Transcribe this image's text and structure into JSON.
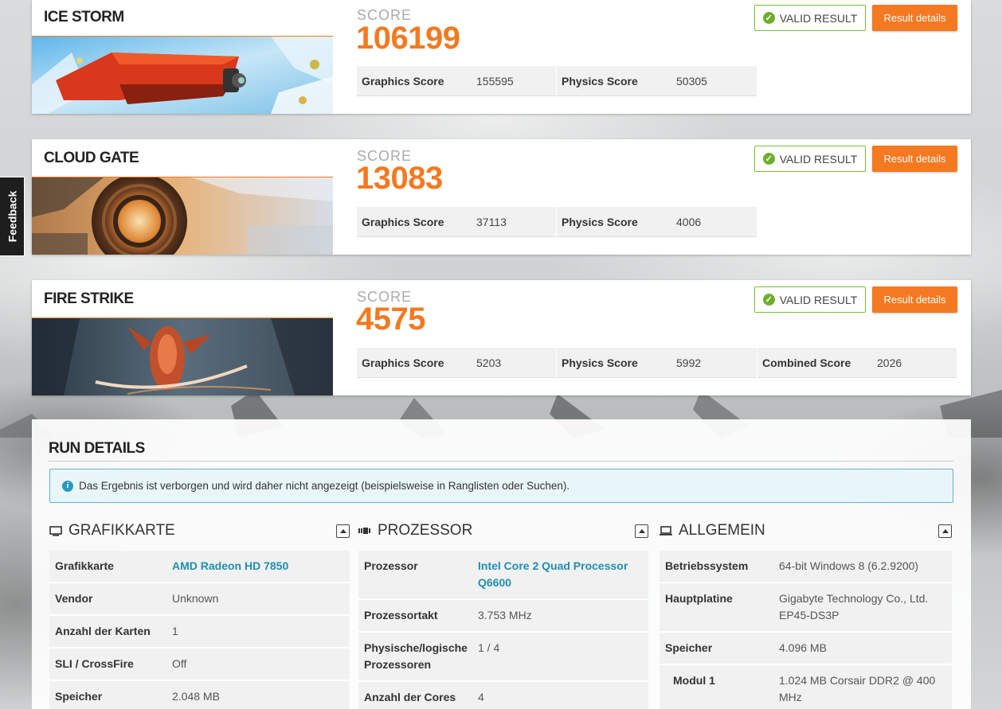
{
  "feedback": {
    "label": "Feedback"
  },
  "benchmarks": [
    {
      "title": "ICE STORM",
      "score_label": "SCORE",
      "score": "106199",
      "valid_label": "VALID RESULT",
      "details_label": "Result details",
      "subscores": [
        {
          "name": "Graphics Score",
          "value": "155595"
        },
        {
          "name": "Physics Score",
          "value": "50305"
        }
      ]
    },
    {
      "title": "CLOUD GATE",
      "score_label": "SCORE",
      "score": "13083",
      "valid_label": "VALID RESULT",
      "details_label": "Result details",
      "subscores": [
        {
          "name": "Graphics Score",
          "value": "37113"
        },
        {
          "name": "Physics Score",
          "value": "4006"
        }
      ]
    },
    {
      "title": "FIRE STRIKE",
      "score_label": "SCORE",
      "score": "4575",
      "valid_label": "VALID RESULT",
      "details_label": "Result details",
      "subscores": [
        {
          "name": "Graphics Score",
          "value": "5203"
        },
        {
          "name": "Physics Score",
          "value": "5992"
        },
        {
          "name": "Combined Score",
          "value": "2026"
        }
      ]
    }
  ],
  "run_details": {
    "title": "RUN DETAILS",
    "info_text": "Das Ergebnis ist verborgen und wird daher nicht angezeigt (beispielsweise in Ranglisten oder Suchen).",
    "columns": [
      {
        "title": "GRAFIKKARTE",
        "icon": "monitor-icon",
        "rows": [
          {
            "key": "Grafikkarte",
            "value": "AMD Radeon HD 7850"
          },
          {
            "key": "Vendor",
            "value": "Unknown"
          },
          {
            "key": "Anzahl der Karten",
            "value": "1"
          },
          {
            "key": "SLI / CrossFire",
            "value": "Off"
          },
          {
            "key": "Speicher",
            "value": "2.048 MB"
          }
        ]
      },
      {
        "title": "PROZESSOR",
        "icon": "chip-icon",
        "rows": [
          {
            "key": "Prozessor",
            "value": "Intel Core 2 Quad Processor Q6600"
          },
          {
            "key": "Prozessortakt",
            "value": "3.753 MHz"
          },
          {
            "key": "Physische/logische Prozessoren",
            "value": "1 / 4"
          },
          {
            "key": "Anzahl der Cores",
            "value": "4"
          }
        ]
      },
      {
        "title": "ALLGEMEIN",
        "icon": "laptop-icon",
        "rows": [
          {
            "key": "Betriebssystem",
            "value": "64-bit Windows 8 (6.2.9200)"
          },
          {
            "key": "Hauptplatine",
            "value": "Gigabyte Technology Co., Ltd. EP45-DS3P"
          },
          {
            "key": "Speicher",
            "value": "4.096 MB"
          },
          {
            "key": "Modul 1",
            "value": "1.024 MB Corsair DDR2 @ 400 MHz"
          }
        ]
      }
    ]
  },
  "colors": {
    "accent": "#f47920",
    "valid": "#6fae2c",
    "link": "#1f8fb0",
    "info": "#2a9bbd"
  }
}
